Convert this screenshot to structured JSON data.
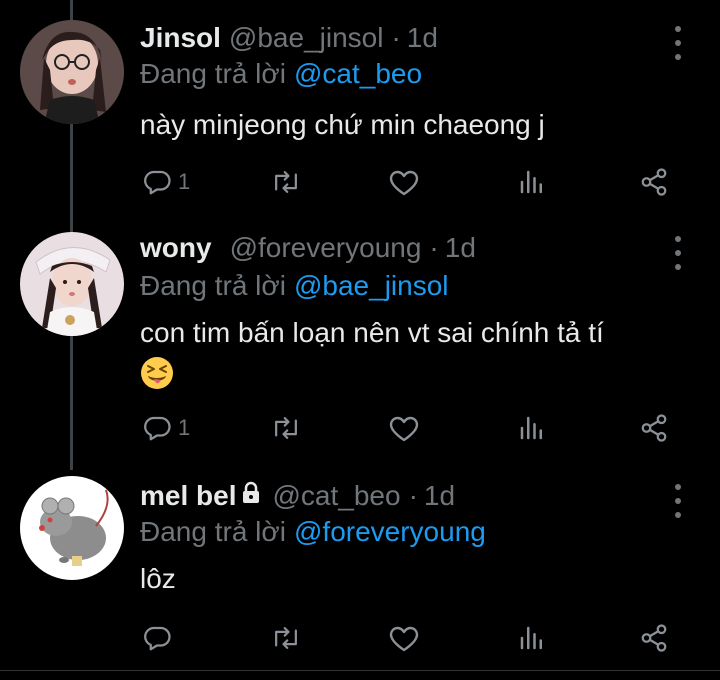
{
  "colors": {
    "background": "#000000",
    "text": "#e7e9ea",
    "muted": "#71767b",
    "mention": "#1d9bf0"
  },
  "tweets": [
    {
      "display_name": "Jinsol",
      "handle": "@bae_jinsol",
      "separator": "·",
      "time": "1d",
      "reply_prefix": "Đang trả lời",
      "reply_to": "@cat_beo",
      "text": "này minjeong chứ min chaeong j",
      "reply_count": "1",
      "locked": false
    },
    {
      "display_name": "wony",
      "handle": "@foreveryoung",
      "separator": "·",
      "time": "1d",
      "reply_prefix": "Đang trả lời",
      "reply_to": "@bae_jinsol",
      "text": "con tim bấn loạn nên vt sai chính tả tí",
      "emoji": "squinting-face-with-tongue",
      "reply_count": "1",
      "locked": false
    },
    {
      "display_name": "mel bel",
      "handle": "@cat_beo",
      "separator": "·",
      "time": "1d",
      "reply_prefix": "Đang trả lời",
      "reply_to": "@foreveryoung",
      "text": "lôz",
      "reply_count": "",
      "locked": true
    }
  ],
  "icons": {
    "more": "more-vertical-icon",
    "reply": "reply-bubble-icon",
    "retweet": "retweet-icon",
    "like": "heart-icon",
    "views": "bar-chart-icon",
    "share": "share-icon",
    "lock": "lock-icon"
  }
}
